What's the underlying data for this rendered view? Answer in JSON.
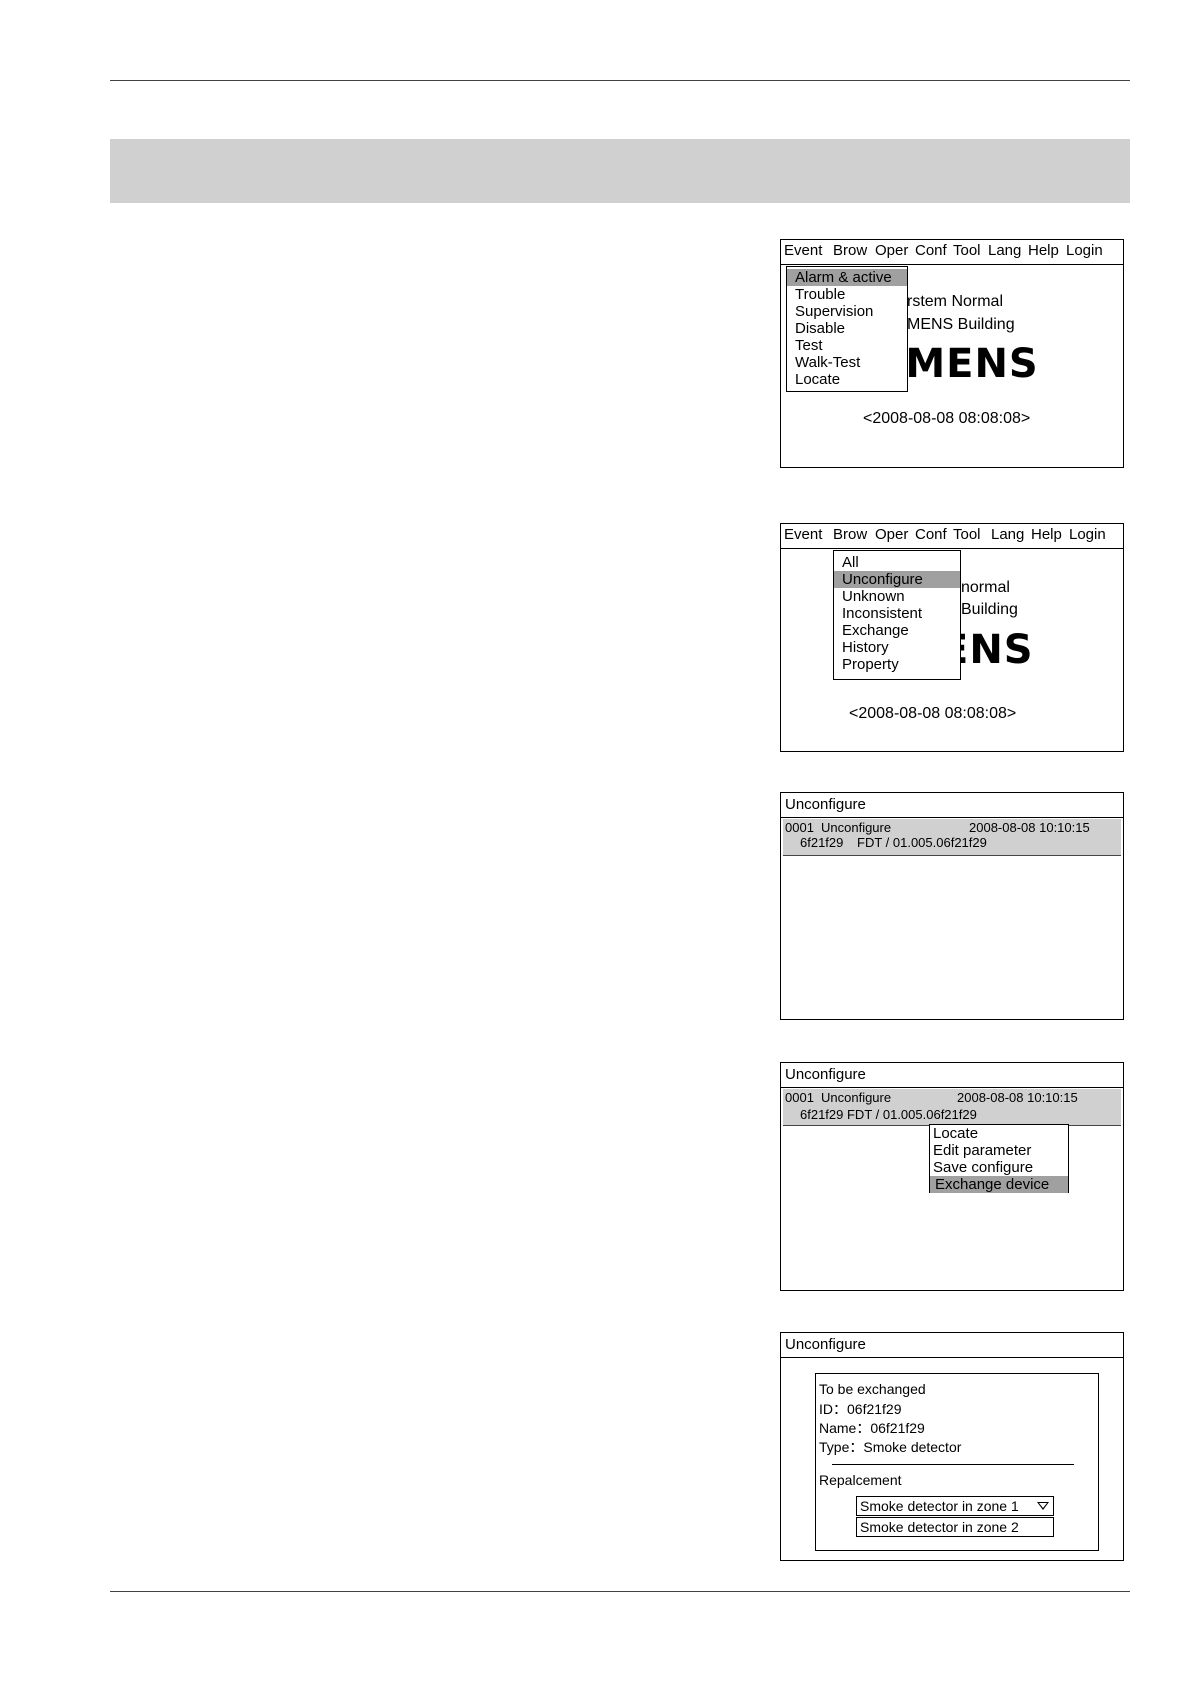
{
  "screen1": {
    "menu": [
      "Event",
      "Brow",
      "Oper",
      "Conf",
      "Tool",
      "Lang",
      "Help",
      "Login"
    ],
    "dropdown": [
      "Alarm & active",
      "Trouble",
      "Supervision",
      "Disable",
      "Test",
      "Walk-Test",
      "Locate"
    ],
    "selected": "Alarm & active",
    "bg_line1": "rstem Normal",
    "bg_line2": "MENS Building",
    "logo": "EMENS",
    "datetime": "<2008-08-08   08:08:08>"
  },
  "screen2": {
    "menu": [
      "Event",
      "Brow",
      "Oper",
      "Conf",
      "Tool",
      "Lang",
      "Help",
      "Login"
    ],
    "dropdown": [
      "All",
      "Unconfigure",
      "Unknown",
      "Inconsistent",
      "Exchange",
      "History",
      "Property"
    ],
    "selected": "Unconfigure",
    "bg_line1": "normal",
    "bg_line2": "Building",
    "logo": "ENS",
    "datetime": "<2008-08-08   08:08:08>"
  },
  "screen3": {
    "title": "Unconfigure",
    "event": {
      "index": "0001",
      "type": "Unconfigure",
      "timestamp": "2008-08-08  10:10:15",
      "id": "6f21f29",
      "address": "FDT / 01.005.06f21f29"
    }
  },
  "screen4": {
    "title": "Unconfigure",
    "event": {
      "index": "0001",
      "type": "Unconfigure",
      "timestamp": "2008-08-08  10:10:15",
      "detail": "6f21f29 FDT / 01.005.06f21f29"
    },
    "context_menu": [
      "Locate",
      "Edit parameter",
      "Save configure",
      "Exchange device"
    ],
    "selected": "Exchange device"
  },
  "screen5": {
    "title": "Unconfigure",
    "dialog": {
      "heading": "To be exchanged",
      "id_line": "ID：06f21f29",
      "name_line": "Name：06f21f29",
      "type_line": "Type：Smoke detector",
      "replacement_label": "Repalcement",
      "options": [
        "Smoke detector in zone 1",
        "Smoke detector in zone 2"
      ]
    }
  }
}
